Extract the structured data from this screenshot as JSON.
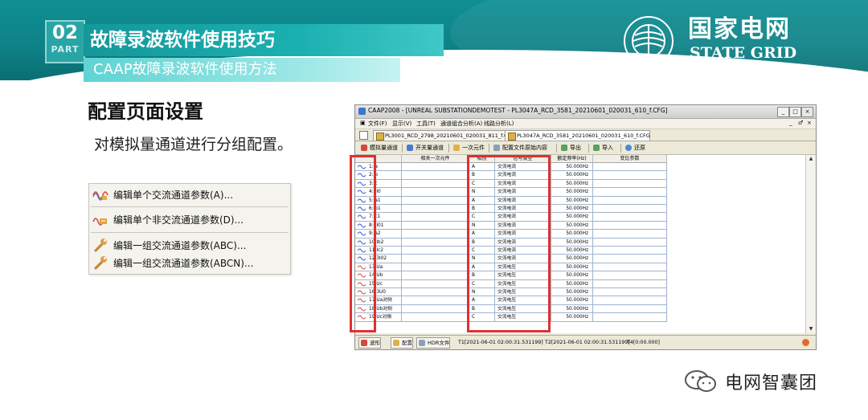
{
  "header": {
    "part_number": "02",
    "part_word": "PART",
    "title": "故障录波软件使用技巧",
    "subtitle": "CAAP故障录波软件使用方法",
    "logo_cn": "国家电网",
    "logo_en": "STATE GRID",
    "colors": {
      "teal": "#0f8f93",
      "light_teal": "#9ee8e6"
    }
  },
  "content": {
    "section_title": "配置页面设置",
    "section_desc": "对模拟量通道进行分组配置。"
  },
  "context_menu": {
    "items": [
      {
        "label": "编辑单个交流通道参数(A)...",
        "icon": "ac-wave-edit-icon"
      },
      {
        "label": "编辑单个非交流通道参数(D)...",
        "icon": "dc-wave-edit-icon"
      },
      {
        "label": "编辑一组交流通道参数(ABC)...",
        "icon": "wrench-icon"
      },
      {
        "label": "编辑一组交流通道参数(ABCN)...",
        "icon": "wrench-icon"
      }
    ]
  },
  "app": {
    "window_title": "CAAP2008 - [UNREAL SUBSTATIONDEMOTEST - PL3047A_RCD_3581_20210601_020031_610_f.CFG]",
    "title_buttons": [
      "_",
      "□",
      "×"
    ],
    "mdi_buttons": [
      "_",
      "♂",
      "×"
    ],
    "menu": [
      "文件(F)",
      "显示(V)",
      "工具(T)",
      "通道组合分析(A)",
      "线路分析(L)"
    ],
    "tabs": [
      "PL3001_RCD_2798_20210601_020031_811_f.CFG",
      "PL3047A_RCD_3581_20210601_020031_610_f.CFG"
    ],
    "toolbar": [
      "模拟量通道",
      "开关量通道",
      "一次元件",
      "配置文件原始内容",
      "导出",
      "导入",
      "还原"
    ],
    "columns": [
      "",
      "相关一次元件",
      "相别",
      "信号类型",
      "额定频率(Hz)",
      "变比参数"
    ],
    "channels": [
      {
        "name": "1:Ia",
        "phase": "A",
        "type": "交流电流",
        "freq": "50.000Hz",
        "kind": "current"
      },
      {
        "name": "2:Ib",
        "phase": "B",
        "type": "交流电流",
        "freq": "50.000Hz",
        "kind": "current"
      },
      {
        "name": "3:Ic",
        "phase": "C",
        "type": "交流电流",
        "freq": "50.000Hz",
        "kind": "current"
      },
      {
        "name": "4:3I0",
        "phase": "N",
        "type": "交流电流",
        "freq": "50.000Hz",
        "kind": "current"
      },
      {
        "name": "5:Ia1",
        "phase": "A",
        "type": "交流电流",
        "freq": "50.000Hz",
        "kind": "current"
      },
      {
        "name": "6:Ib1",
        "phase": "B",
        "type": "交流电流",
        "freq": "50.000Hz",
        "kind": "current"
      },
      {
        "name": "7:Ic1",
        "phase": "C",
        "type": "交流电流",
        "freq": "50.000Hz",
        "kind": "current"
      },
      {
        "name": "8:3I01",
        "phase": "N",
        "type": "交流电流",
        "freq": "50.000Hz",
        "kind": "current"
      },
      {
        "name": "9:Ia2",
        "phase": "A",
        "type": "交流电流",
        "freq": "50.000Hz",
        "kind": "current"
      },
      {
        "name": "10:Ib2",
        "phase": "B",
        "type": "交流电流",
        "freq": "50.000Hz",
        "kind": "current"
      },
      {
        "name": "11:Ic2",
        "phase": "C",
        "type": "交流电流",
        "freq": "50.000Hz",
        "kind": "current"
      },
      {
        "name": "12:3I02",
        "phase": "N",
        "type": "交流电流",
        "freq": "50.000Hz",
        "kind": "current"
      },
      {
        "name": "13:Ua",
        "phase": "A",
        "type": "交流电压",
        "freq": "50.000Hz",
        "kind": "voltage"
      },
      {
        "name": "14:Ub",
        "phase": "B",
        "type": "交流电压",
        "freq": "50.000Hz",
        "kind": "voltage"
      },
      {
        "name": "15:Uc",
        "phase": "C",
        "type": "交流电压",
        "freq": "50.000Hz",
        "kind": "voltage"
      },
      {
        "name": "16:3U0",
        "phase": "N",
        "type": "交流电压",
        "freq": "50.000Hz",
        "kind": "voltage"
      },
      {
        "name": "17:Ua对侧",
        "phase": "A",
        "type": "交流电压",
        "freq": "50.000Hz",
        "kind": "voltage"
      },
      {
        "name": "18:Ub对侧",
        "phase": "B",
        "type": "交流电压",
        "freq": "50.000Hz",
        "kind": "voltage"
      },
      {
        "name": "19:Uc对侧",
        "phase": "C",
        "type": "交流电压",
        "freq": "50.000Hz",
        "kind": "voltage"
      }
    ],
    "status_tabs": [
      "波形",
      "配置",
      "HDR文件"
    ],
    "status_t1": "T1[2021-06-01 02:00:31.531199]",
    "status_t2": "T2[2021-06-01 02:00:31.531199]",
    "status_t4": "T4[0:00.000]"
  },
  "watermark": "电网智囊团"
}
